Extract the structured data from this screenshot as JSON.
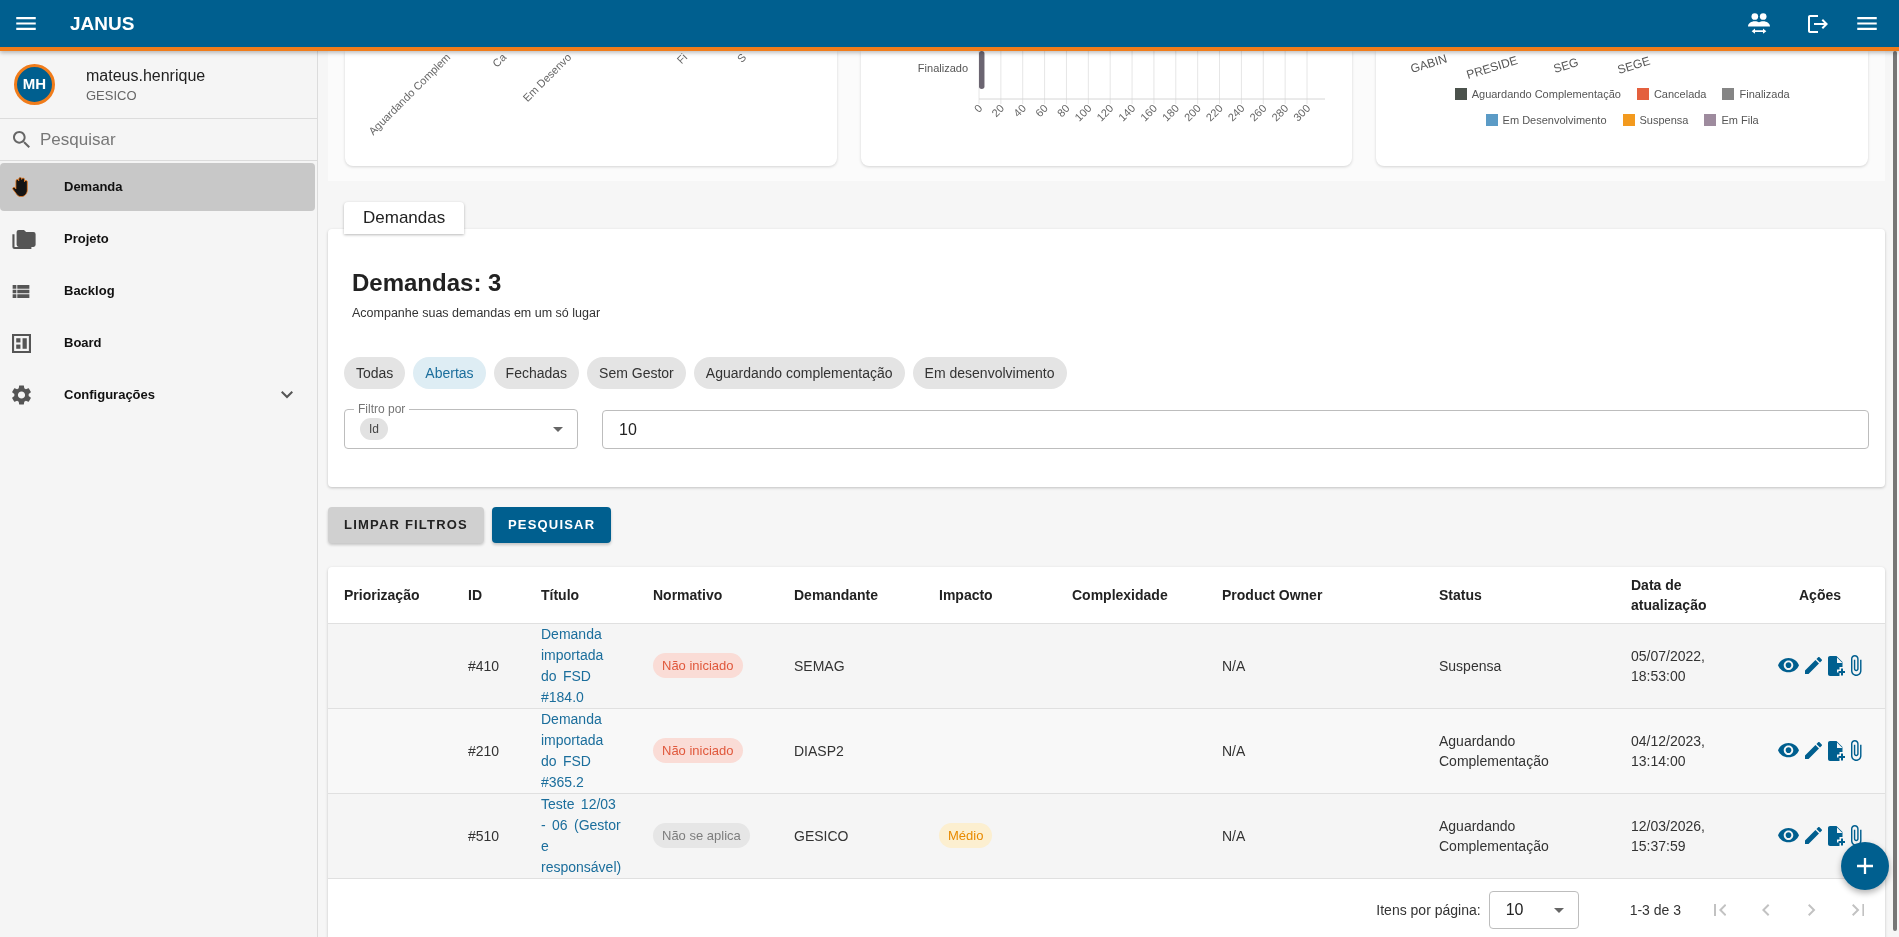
{
  "header": {
    "title": "JANUS"
  },
  "user": {
    "initials": "MH",
    "name": "mateus.henrique",
    "unit": "GESICO"
  },
  "sidebar": {
    "search": {
      "placeholder": "Pesquisar"
    },
    "items": [
      {
        "label": "Demanda",
        "kind": "link",
        "selected": true
      },
      {
        "label": "Projeto",
        "kind": "link",
        "selected": false
      },
      {
        "label": "Backlog",
        "kind": "link",
        "selected": false
      },
      {
        "label": "Board",
        "kind": "link",
        "selected": false
      },
      {
        "label": "Configurações",
        "kind": "group",
        "selected": false,
        "expanded": false
      }
    ]
  },
  "dashboard": {
    "chart_1": {
      "axis_labels": [
        "Aguardando Complem",
        "Ca",
        "Em Desenvo",
        "Fi",
        "S"
      ]
    },
    "chart_2": {
      "chart_data": {
        "type": "bar",
        "orientation": "horizontal",
        "categories": [
          "Finalizado"
        ],
        "series": [
          {
            "color": "#6b6571",
            "values": [
              5
            ]
          }
        ],
        "xlim": [
          0,
          300
        ],
        "xticks": [
          0,
          20,
          40,
          60,
          80,
          100,
          120,
          140,
          160,
          180,
          200,
          220,
          240,
          260,
          280,
          300
        ],
        "grid": true
      }
    },
    "chart_3": {
      "axis_labels": [
        "GABIN",
        "PRESIDE",
        "SEG",
        "SEGE"
      ],
      "legend": [
        {
          "label": "Aguardando Complementação",
          "color": "#4b524c"
        },
        {
          "label": "Cancelada",
          "color": "#e4603e"
        },
        {
          "label": "Finalizada",
          "color": "#858585"
        },
        {
          "label": "Em Desenvolvimento",
          "color": "#5b9bc6"
        },
        {
          "label": "Suspensa",
          "color": "#f39a1e"
        },
        {
          "label": "Em Fila",
          "color": "#9e8b9e"
        }
      ]
    }
  },
  "demandas": {
    "tab": "Demandas",
    "title": "Demandas: 3",
    "subtitle": "Acompanhe suas demandas em um só lugar",
    "filters": [
      {
        "label": "Todas",
        "selected": false
      },
      {
        "label": "Abertas",
        "selected": true
      },
      {
        "label": "Fechadas",
        "selected": false
      },
      {
        "label": "Sem Gestor",
        "selected": false
      },
      {
        "label": "Aguardando complementação",
        "selected": false
      },
      {
        "label": "Em desenvolvimento",
        "selected": false
      }
    ],
    "filter_by": {
      "label": "Filtro por",
      "value": "Id"
    },
    "search_value": "10"
  },
  "buttons": [
    {
      "label": "LIMPAR FILTROS",
      "kind": "secondary"
    },
    {
      "label": "PESQUISAR",
      "kind": "primary"
    }
  ],
  "table": {
    "columns": [
      "Priorização",
      "ID",
      "Título",
      "Normativo",
      "Demandante",
      "Impacto",
      "Complexidade",
      "Product Owner",
      "Status",
      "Data de atualização",
      "Ações"
    ],
    "rows": [
      {
        "id": "#410",
        "title": "Demanda importada do FSD #184.0",
        "normativo": {
          "text": "Não iniciado",
          "kind": "danger"
        },
        "demandante": "SEMAG",
        "product_owner": "N/A",
        "status": "Suspensa",
        "updated": "05/07/2022, 18:53:00"
      },
      {
        "id": "#210",
        "title": "Demanda importada do FSD #365.2",
        "normativo": {
          "text": "Não iniciado",
          "kind": "danger"
        },
        "demandante": "DIASP2",
        "product_owner": "N/A",
        "status": "Aguardando Complementação",
        "updated": "04/12/2023, 13:14:00"
      },
      {
        "id": "#510",
        "title": "Teste 12/03 - 06 (Gestor e responsável)",
        "normativo": {
          "text": "Não se aplica",
          "kind": "neutral"
        },
        "demandante": "GESICO",
        "impacto": {
          "text": "Médio",
          "kind": "warning"
        },
        "product_owner": "N/A",
        "status": "Aguardando Complementação",
        "updated": "12/03/2026, 15:37:59"
      }
    ]
  },
  "pagination": {
    "label": "Itens por página:",
    "page_size": "10",
    "range": "1-3 de 3",
    "buttons": [
      {
        "kind": "first",
        "disabled": true
      },
      {
        "kind": "previous",
        "disabled": true
      },
      {
        "kind": "next",
        "disabled": true
      },
      {
        "kind": "last",
        "disabled": true
      }
    ]
  }
}
